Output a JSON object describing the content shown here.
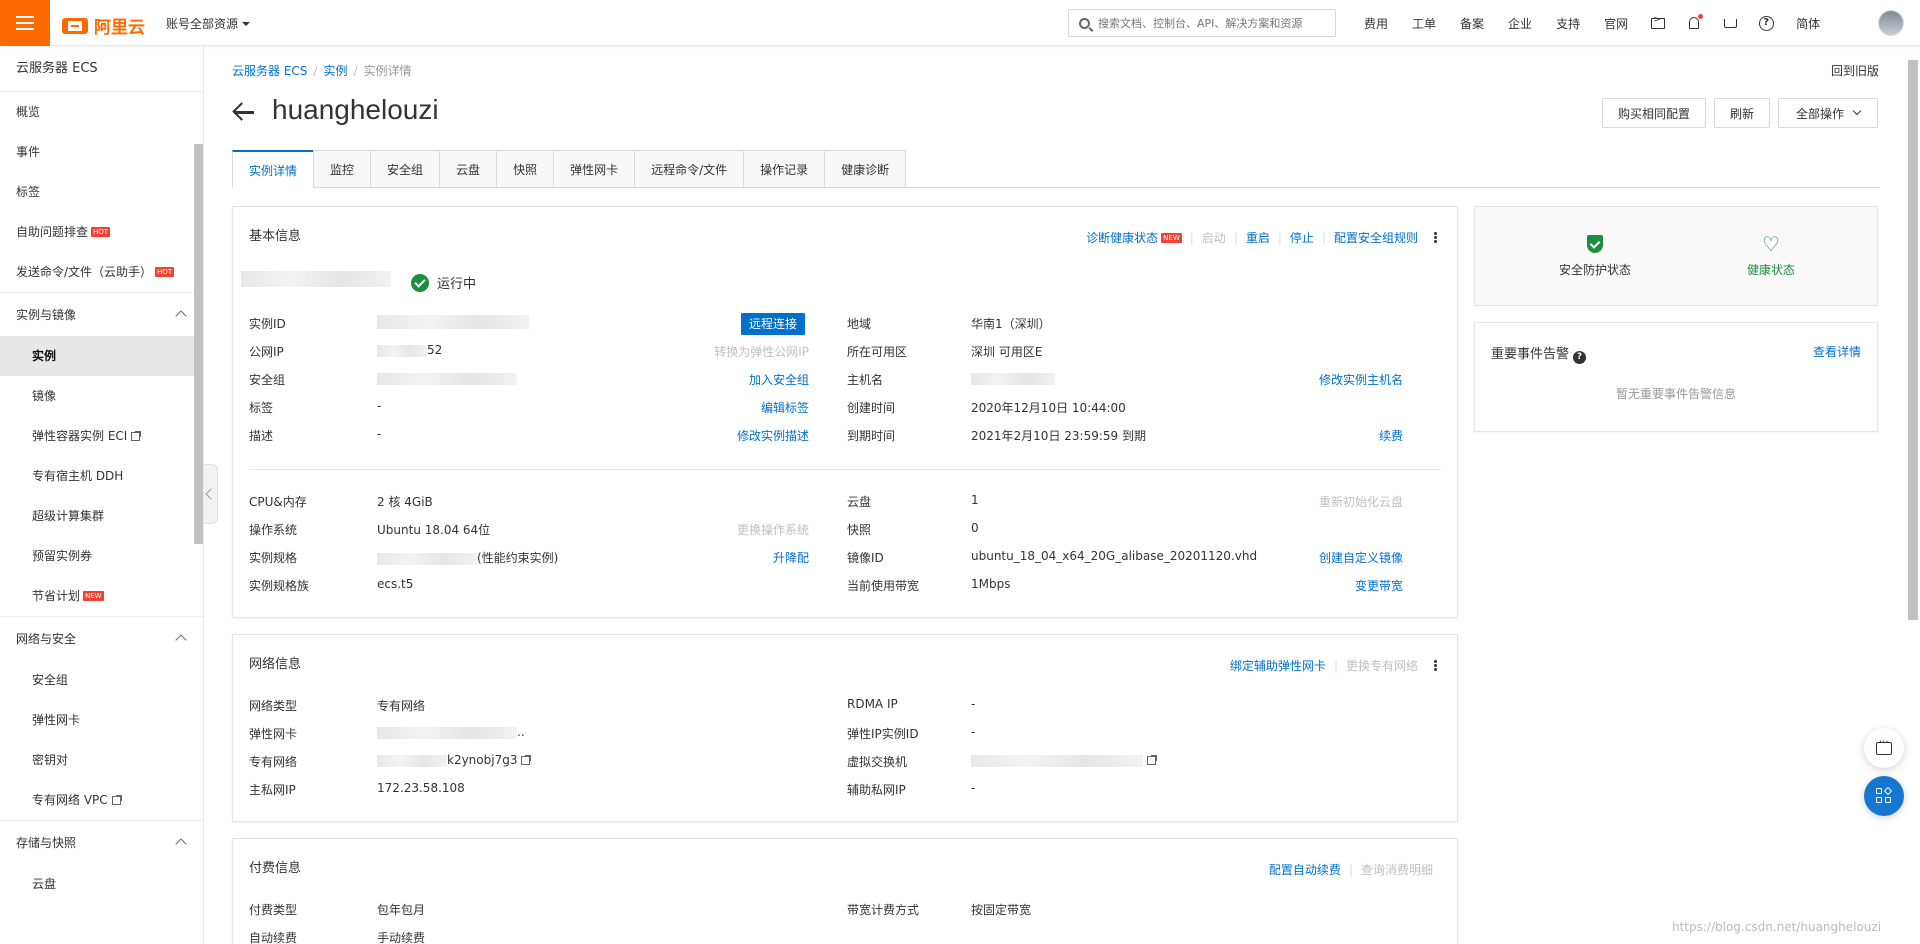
{
  "topbar": {
    "logo_text": "阿里云",
    "account": "账号全部资源",
    "search_placeholder": "搜索文档、控制台、API、解决方案和资源",
    "nav": [
      "费用",
      "工单",
      "备案",
      "企业",
      "支持",
      "官网"
    ],
    "lang": "简体",
    "accent": "#ff6a00"
  },
  "sidebar": {
    "title": "云服务器 ECS",
    "top_items": [
      {
        "label": "概览"
      },
      {
        "label": "事件"
      },
      {
        "label": "标签"
      },
      {
        "label": "自助问题排查",
        "badge": "HOT"
      },
      {
        "label": "发送命令/文件（云助手）",
        "badge": "HOT"
      }
    ],
    "group1": {
      "label": "实例与镜像",
      "items": [
        "实例",
        "镜像",
        "弹性容器实例 ECI",
        "专有宿主机 DDH",
        "超级计算集群",
        "预留实例券",
        "节省计划"
      ]
    },
    "group1_new_badge": "NEW",
    "group2": {
      "label": "网络与安全",
      "items": [
        "安全组",
        "弹性网卡",
        "密钥对",
        "专有网络 VPC"
      ]
    },
    "group3": {
      "label": "存储与快照",
      "items": [
        "云盘"
      ]
    }
  },
  "breadcrumb": {
    "items": [
      "云服务器 ECS",
      "实例",
      "实例详情"
    ]
  },
  "old_version": "回到旧版",
  "page": {
    "title": "huanghelouzi",
    "buttons": {
      "buy_same": "购买相同配置",
      "refresh": "刷新",
      "all_ops": "全部操作"
    }
  },
  "tabs": [
    "实例详情",
    "监控",
    "安全组",
    "云盘",
    "快照",
    "弹性网卡",
    "远程命令/文件",
    "操作记录",
    "健康诊断"
  ],
  "basic": {
    "title": "基本信息",
    "actions": {
      "diagnose": "诊断健康状态",
      "new_badge": "NEW",
      "start": "启动",
      "restart": "重启",
      "stop": "停止",
      "config_sg": "配置安全组规则"
    },
    "status": "运行中",
    "remote_connect": "远程连接",
    "left": [
      {
        "k": "实例ID",
        "v": ""
      },
      {
        "k": "公网IP",
        "v": "52",
        "act": "转换为弹性公网IP",
        "act_disabled": true
      },
      {
        "k": "安全组",
        "v": "",
        "act": "加入安全组"
      },
      {
        "k": "标签",
        "v": "-",
        "act": "编辑标签"
      },
      {
        "k": "描述",
        "v": "-",
        "act": "修改实例描述"
      }
    ],
    "right": [
      {
        "k": "地域",
        "v": "华南1（深圳）"
      },
      {
        "k": "所在可用区",
        "v": "深圳 可用区E"
      },
      {
        "k": "主机名",
        "v": "",
        "act": "修改实例主机名"
      },
      {
        "k": "创建时间",
        "v": "2020年12月10日 10:44:00"
      },
      {
        "k": "到期时间",
        "v": "2021年2月10日 23:59:59 到期",
        "act": "续费"
      }
    ],
    "left2": [
      {
        "k": "CPU&内存",
        "v": "2 核 4GiB"
      },
      {
        "k": "操作系统",
        "v": "Ubuntu 18.04 64位",
        "act": "更换操作系统",
        "act_disabled": true
      },
      {
        "k": "实例规格",
        "v": "(性能约束实例)",
        "act": "升降配"
      },
      {
        "k": "实例规格族",
        "v": "ecs.t5"
      }
    ],
    "right2": [
      {
        "k": "云盘",
        "v": "1",
        "act": "重新初始化云盘",
        "act_disabled": true
      },
      {
        "k": "快照",
        "v": "0"
      },
      {
        "k": "镜像ID",
        "v": "ubuntu_18_04_x64_20G_alibase_20201120.vhd",
        "act": "创建自定义镜像"
      },
      {
        "k": "当前使用带宽",
        "v": "1Mbps",
        "act": "变更带宽"
      }
    ]
  },
  "network": {
    "title": "网络信息",
    "actions": {
      "bind": "绑定辅助弹性网卡",
      "change": "更换专有网络"
    },
    "left": [
      {
        "k": "网络类型",
        "v": "专有网络"
      },
      {
        "k": "弹性网卡",
        "v": ".."
      },
      {
        "k": "专有网络",
        "v": "k2ynobj7g3"
      },
      {
        "k": "主私网IP",
        "v": "172.23.58.108"
      }
    ],
    "right": [
      {
        "k": "RDMA IP",
        "v": "-"
      },
      {
        "k": "弹性IP实例ID",
        "v": "-"
      },
      {
        "k": "虚拟交换机",
        "v": ""
      },
      {
        "k": "辅助私网IP",
        "v": "-"
      }
    ]
  },
  "billing": {
    "title": "付费信息",
    "actions": {
      "auto_renew": "配置自动续费",
      "detail": "查询消费明细"
    },
    "left": [
      {
        "k": "付费类型",
        "v": "包年包月"
      },
      {
        "k": "自动续费",
        "v": "手动续费"
      }
    ],
    "right": [
      {
        "k": "带宽计费方式",
        "v": "按固定带宽"
      }
    ]
  },
  "status_panel": {
    "security": "安全防护状态",
    "health": "健康状态"
  },
  "events": {
    "title": "重要事件告警",
    "link": "查看详情",
    "empty": "暂无重要事件告警信息"
  },
  "watermark": "https://blog.csdn.net/huanghelouzi"
}
